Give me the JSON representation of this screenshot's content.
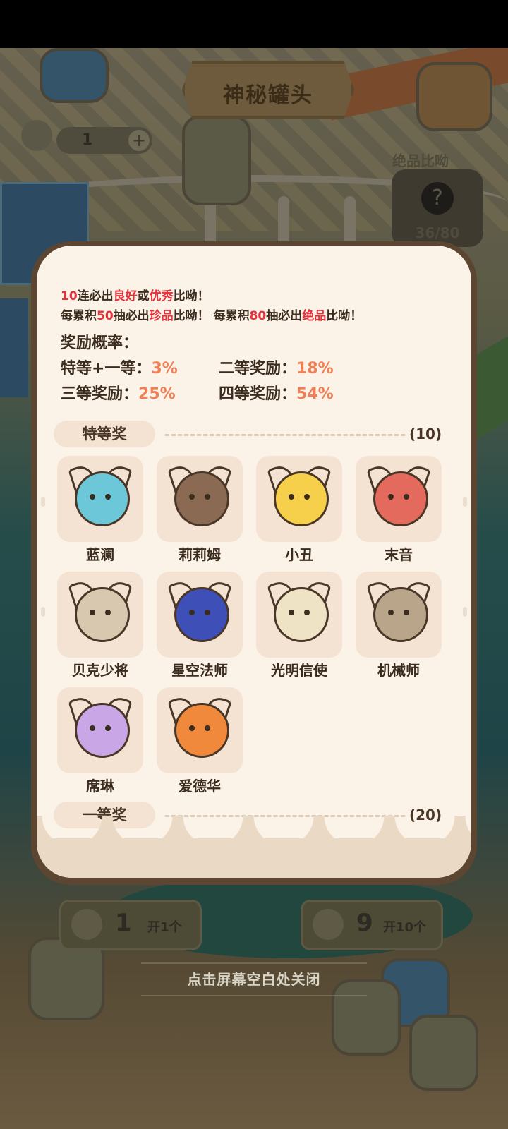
{
  "background": {
    "title": "神秘罐头",
    "ticket_count": "1",
    "plus_symbol": "+",
    "rare_label": "绝品比呦",
    "rare_symbol": "?",
    "rare_progress": "36/80",
    "open_one": {
      "count": "1",
      "label": "开1个"
    },
    "open_ten": {
      "count": "9",
      "label": "开10个"
    },
    "close_hint": "点击屏幕空白处关闭"
  },
  "rules": {
    "line1": {
      "a": "10",
      "b": "连必出",
      "c": "良好",
      "d": "或",
      "e": "优秀",
      "f": "比呦！"
    },
    "line2": {
      "a": "每累积",
      "b": "50",
      "c": "抽必出",
      "d": "珍品",
      "e": "比呦！ 每累积",
      "f": "80",
      "g": "抽必出",
      "h": "绝品",
      "i": "比呦！"
    },
    "prob_title": "奖励概率：",
    "probs": [
      {
        "label": "特等+一等：",
        "value": "3%"
      },
      {
        "label": "二等奖励：",
        "value": "18%"
      },
      {
        "label": "三等奖励：",
        "value": "25%"
      },
      {
        "label": "四等奖励：",
        "value": "54%"
      }
    ]
  },
  "sections": [
    {
      "title": "特等奖",
      "count": "(10)"
    },
    {
      "title": "一等奖",
      "count": "(20)"
    }
  ],
  "items": [
    {
      "name": "蓝澜",
      "color": "#6cc7d8"
    },
    {
      "name": "莉莉姆",
      "color": "#8a6a52"
    },
    {
      "name": "小丑",
      "color": "#f6d04a"
    },
    {
      "name": "末音",
      "color": "#e46a5e"
    },
    {
      "name": "贝克少将",
      "color": "#d8c8b0"
    },
    {
      "name": "星空法师",
      "color": "#3f4fb8"
    },
    {
      "name": "光明信使",
      "color": "#efe3c6"
    },
    {
      "name": "机械师",
      "color": "#b8a58a"
    },
    {
      "name": "席琳",
      "color": "#c9a6e6"
    },
    {
      "name": "爱德华",
      "color": "#f0893c"
    }
  ]
}
